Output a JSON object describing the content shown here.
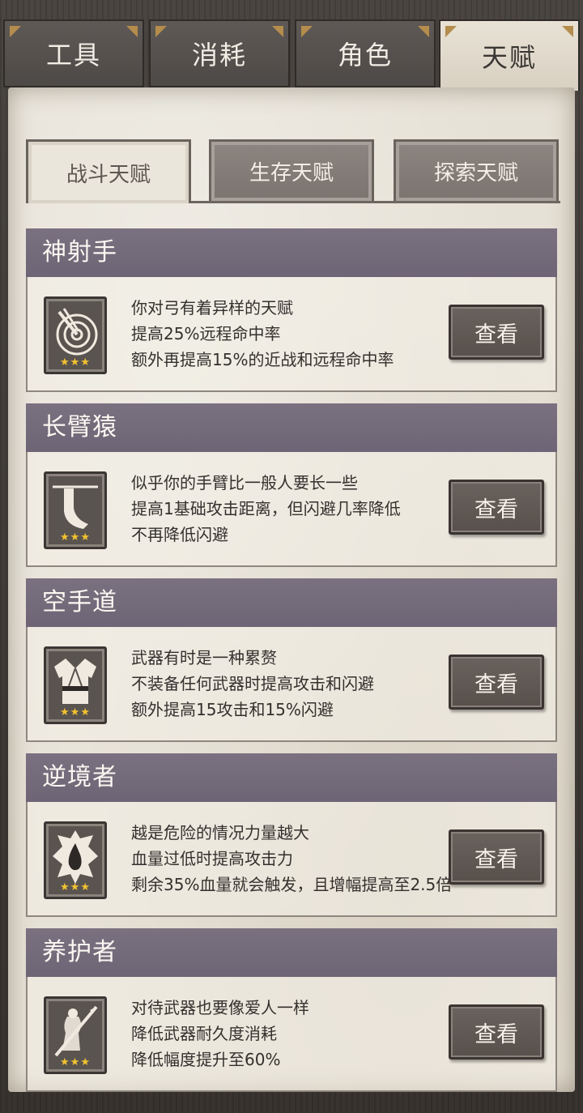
{
  "top_tabs": [
    {
      "label": "工具",
      "active": false
    },
    {
      "label": "消耗",
      "active": false
    },
    {
      "label": "角色",
      "active": false
    },
    {
      "label": "天赋",
      "active": true
    }
  ],
  "sub_tabs": [
    {
      "label": "战斗天赋",
      "active": true
    },
    {
      "label": "生存天赋",
      "active": false
    },
    {
      "label": "探索天赋",
      "active": false
    }
  ],
  "talents": [
    {
      "name": "神射手",
      "icon": "archery-target-icon",
      "stars": "★★★",
      "lines": [
        "你对弓有着异样的天赋",
        "提高25%远程命中率",
        "额外再提高15%的近战和远程命中率"
      ],
      "button": "查看"
    },
    {
      "name": "长臂猿",
      "icon": "long-arm-icon",
      "stars": "★★★",
      "lines": [
        "似乎你的手臂比一般人要长一些",
        "提高1基础攻击距离，但闪避几率降低",
        "不再降低闪避"
      ],
      "button": "查看"
    },
    {
      "name": "空手道",
      "icon": "karate-gi-icon",
      "stars": "★★★",
      "lines": [
        "武器有时是一种累赘",
        "不装备任何武器时提高攻击和闪避",
        "额外提高15攻击和15%闪避"
      ],
      "button": "查看"
    },
    {
      "name": "逆境者",
      "icon": "blood-drop-icon",
      "stars": "★★★",
      "lines": [
        "越是危险的情况力量越大",
        "血量过低时提高攻击力",
        "剩余35%血量就会触发，且增幅提高至2.5倍"
      ],
      "button": "查看"
    },
    {
      "name": "养护者",
      "icon": "weapon-care-icon",
      "stars": "★★★",
      "lines": [
        "对待武器也要像爱人一样",
        "降低武器耐久度消耗",
        "降低幅度提升至60%"
      ],
      "button": "查看"
    }
  ],
  "colors": {
    "accent_star": "#f2c230",
    "header": "#6f6777",
    "parchment": "#e6e1d6"
  }
}
